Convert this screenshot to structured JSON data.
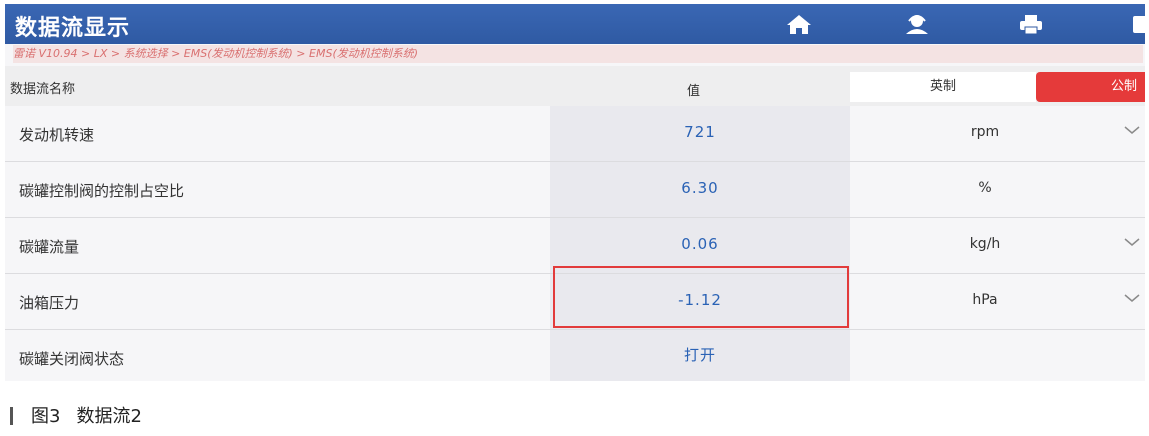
{
  "app": {
    "title": "数据流显示"
  },
  "toolbar": {
    "icons": [
      "home-icon",
      "user-support-icon",
      "printer-icon",
      "more-icon"
    ]
  },
  "breadcrumb": "雷诺 V10.94 > LX > 系统选择 > EMS(发动机控制系统) > EMS(发动机控制系统)",
  "table": {
    "header_name": "数据流名称",
    "header_value": "值",
    "unit_imperial": "英制",
    "unit_metric": "公制",
    "rows": [
      {
        "name": "发动机转速",
        "value": "721",
        "unit": "rpm",
        "has_dropdown": true
      },
      {
        "name": "碳罐控制阀的控制占空比",
        "value": "6.30",
        "unit": "%",
        "has_dropdown": false
      },
      {
        "name": "碳罐流量",
        "value": "0.06",
        "unit": "kg/h",
        "has_dropdown": true
      },
      {
        "name": "油箱压力",
        "value": "-1.12",
        "unit": "hPa",
        "has_dropdown": true
      },
      {
        "name": "碳罐关闭阀状态",
        "value": "打开",
        "unit": "",
        "has_dropdown": false
      }
    ]
  },
  "caption": {
    "figure": "图3",
    "text": "数据流2"
  },
  "colors": {
    "titlebar": "#2f5aa3",
    "value_text": "#2a62b5",
    "metric_active": "#e53a3a",
    "highlight": "#e23b3b"
  }
}
